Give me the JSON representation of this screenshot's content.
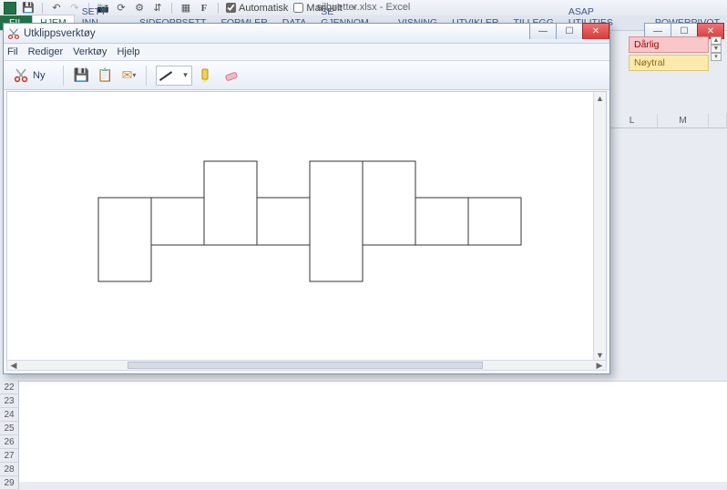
{
  "excel": {
    "title": "silhuetter.xlsx - Excel",
    "qat_checks": {
      "auto": "Automatisk",
      "manual": "Manuelt",
      "f_label": "F"
    },
    "tabs": {
      "file": "FIL",
      "home": "HJEM",
      "insert": "SETT INN",
      "page": "SIDEOPPSETT",
      "formulas": "FORMLER",
      "data": "DATA",
      "review": "SE GJENNOM",
      "view": "VISNING",
      "developer": "UTVIKLER",
      "addins": "TILLEGG",
      "asap": "ASAP UTILITIES",
      "powerpivot": "POWERPIVOT"
    },
    "styles": {
      "bad": "Dårlig",
      "neutral": "Nøytral"
    },
    "cols": {
      "l": "L",
      "m": "M"
    },
    "rows": [
      "22",
      "23",
      "24",
      "25",
      "26",
      "27",
      "28",
      "29"
    ]
  },
  "sniptool": {
    "title": "Utklippsverktøy",
    "menu": {
      "file": "Fil",
      "edit": "Rediger",
      "tools": "Verktøy",
      "help": "Hjelp"
    },
    "toolbar": {
      "new_label": "Ny"
    }
  }
}
